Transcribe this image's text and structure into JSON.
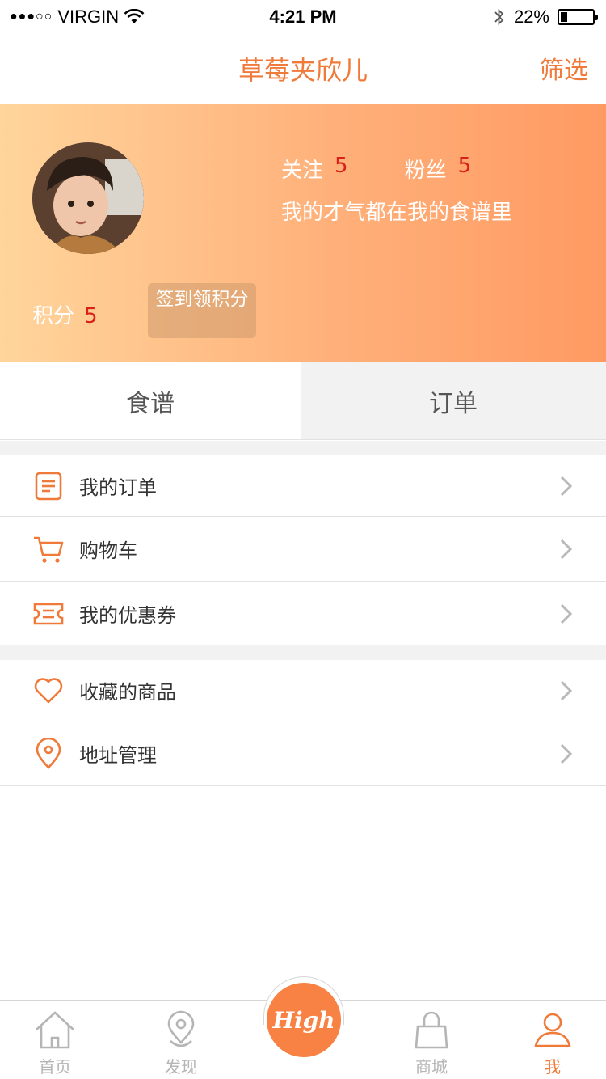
{
  "status_bar": {
    "carrier": "VIRGIN",
    "signal": "●●●○○",
    "time": "4:21 PM",
    "battery_percent": "22%",
    "battery_level": 0.22
  },
  "nav": {
    "title": "草莓夹欣儿",
    "filter_label": "筛选"
  },
  "profile": {
    "follow_label": "关注",
    "follow_count": "5",
    "fans_label": "粉丝",
    "fans_count": "5",
    "bio": "我的才气都在我的食谱里",
    "points_label": "积分",
    "points_value": "5",
    "checkin_label": "签到领积分"
  },
  "tabs": [
    {
      "label": "食谱",
      "active": true
    },
    {
      "label": "订单",
      "active": false
    }
  ],
  "menu_group_1": [
    {
      "label": "我的订单",
      "icon": "order-list-icon"
    },
    {
      "label": "购物车",
      "icon": "cart-icon"
    },
    {
      "label": "我的优惠券",
      "icon": "coupon-icon"
    }
  ],
  "menu_group_2": [
    {
      "label": "收藏的商品",
      "icon": "heart-icon"
    },
    {
      "label": "地址管理",
      "icon": "location-pin-icon"
    }
  ],
  "tab_bar": {
    "home": "首页",
    "discover": "发现",
    "center_button": "High",
    "mall": "商城",
    "me": "我"
  },
  "colors": {
    "accent": "#f07a3a",
    "count_red": "#d8211a",
    "gradient_start": "#ffd59c",
    "gradient_end": "#ff9a62"
  }
}
